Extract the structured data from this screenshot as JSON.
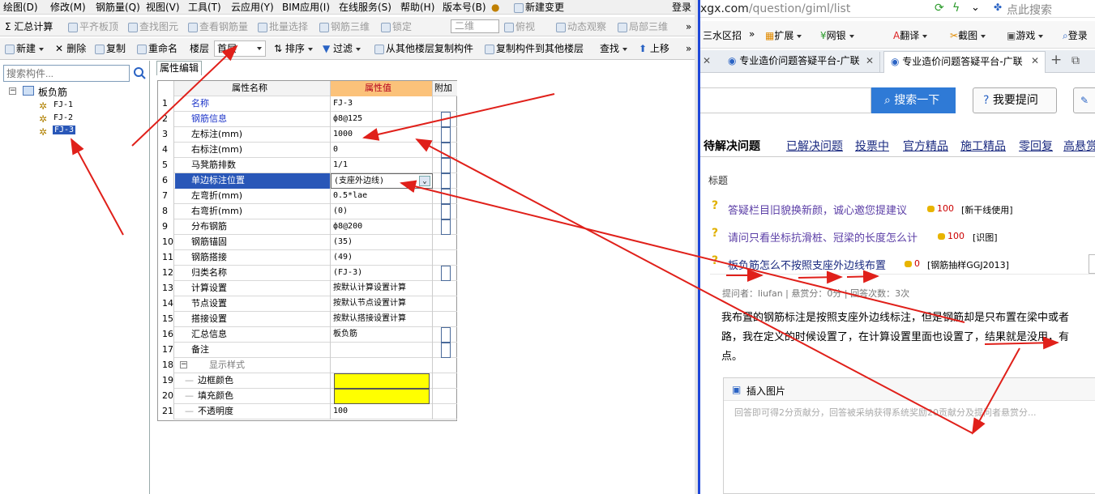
{
  "menu": {
    "items": [
      "绘图(D)",
      "修改(M)",
      "钢筋量(Q)",
      "视图(V)",
      "工具(T)",
      "云应用(Y)",
      "BIM应用(I)",
      "在线服务(S)",
      "帮助(H)",
      "版本号(B)",
      "新建变更"
    ],
    "login": "登录"
  },
  "toolbar1": {
    "summary": "Σ 汇总计算",
    "flat": "平齐板顶",
    "find": "查找图元",
    "view_rebar": "查看钢筋量",
    "batch": "批量选择",
    "rebar3d": "钢筋三维",
    "lock": "锁定",
    "view2d": "二维",
    "top_view": "俯视",
    "dynamic": "动态观察",
    "local3d": "局部三维",
    "more": "»"
  },
  "toolbar2": {
    "new": "新建",
    "delete": "删除",
    "copy": "复制",
    "rename": "重命名",
    "floor_label": "楼层",
    "floor_value": "首层",
    "sort": "排序",
    "filter": "过滤",
    "copy_from": "从其他楼层复制构件",
    "copy_to": "复制构件到其他楼层",
    "find": "查找",
    "up": "上移",
    "more": "»"
  },
  "left_panel": {
    "search_placeholder": "搜索构件...",
    "root": "板负筋",
    "items": [
      "FJ-1",
      "FJ-2",
      "FJ-3"
    ]
  },
  "property_tab": "属性编辑",
  "grid": {
    "headers": {
      "num": "",
      "name": "属性名称",
      "value": "属性值",
      "extra": "附加"
    },
    "rows": [
      {
        "n": "1",
        "name": "名称",
        "value": "FJ-3"
      },
      {
        "n": "2",
        "name": "钢筋信息",
        "value": "ф8@125"
      },
      {
        "n": "3",
        "name": "左标注(mm)",
        "value": "1000"
      },
      {
        "n": "4",
        "name": "右标注(mm)",
        "value": "0"
      },
      {
        "n": "5",
        "name": "马凳筋排数",
        "value": "1/1"
      },
      {
        "n": "6",
        "name": "单边标注位置",
        "value": "(支座外边线)"
      },
      {
        "n": "7",
        "name": "左弯折(mm)",
        "value": "0.5*lae"
      },
      {
        "n": "8",
        "name": "右弯折(mm)",
        "value": "(0)"
      },
      {
        "n": "9",
        "name": "分布钢筋",
        "value": "ф8@200"
      },
      {
        "n": "10",
        "name": "钢筋锚固",
        "value": "(35)"
      },
      {
        "n": "11",
        "name": "钢筋搭接",
        "value": "(49)"
      },
      {
        "n": "12",
        "name": "归类名称",
        "value": "(FJ-3)"
      },
      {
        "n": "13",
        "name": "计算设置",
        "value": "按默认计算设置计算"
      },
      {
        "n": "14",
        "name": "节点设置",
        "value": "按默认节点设置计算"
      },
      {
        "n": "15",
        "name": "搭接设置",
        "value": "按默认搭接设置计算"
      },
      {
        "n": "16",
        "name": "汇总信息",
        "value": "板负筋"
      },
      {
        "n": "17",
        "name": "备注",
        "value": ""
      },
      {
        "n": "18",
        "name": "显示样式",
        "value": ""
      },
      {
        "n": "19",
        "name": "边框颜色",
        "value": ""
      },
      {
        "n": "20",
        "name": "填充颜色",
        "value": ""
      },
      {
        "n": "21",
        "name": "不透明度",
        "value": "100"
      }
    ]
  },
  "browser": {
    "url_host": "xgx.com",
    "url_path": "/question/giml/list",
    "search_placeholder": "点此搜索",
    "bookmarks": [
      "三水区招",
      "»",
      "扩展",
      "网银",
      "翻译",
      "截图",
      "游戏",
      "登录"
    ],
    "tabs": [
      "专业造价问题答疑平台-广联",
      "专业造价问题答疑平台-广联"
    ],
    "search_btn": "搜索一下",
    "ask_btn": "我要提问",
    "nav": [
      "待解决问题",
      "已解决问题",
      "投票中",
      "官方精品",
      "施工精品",
      "零回复",
      "高悬赏"
    ],
    "col_title": "标题",
    "questions": [
      {
        "title": "答疑栏目旧貌换新颜，诚心邀您提建议",
        "score": "100",
        "tag": "[新干线使用]"
      },
      {
        "title": "请问只看坐标抗滑桩、冠梁的长度怎么计",
        "score": "100",
        "tag": "[识图]"
      },
      {
        "title": "板负筋怎么不按照支座外边线布置",
        "score": "0",
        "tag": "[钢筋抽样GGJ2013]"
      }
    ],
    "meta": "提问者：liufan  |  悬赏分：0分  |  回答次数：3次",
    "body_line1": "我布置的钢筋标注是按照支座外边线标注，但是钢筋却是只布置在梁中或者",
    "body_line2": "路，我在定义的时候设置了，在计算设置里面也设置了，结果就是没用，有",
    "body_line3": "点。",
    "insert_image": "插入图片",
    "answer_placeholder": "回答即可得2分贡献分，回答被采纳获得系统奖励20贡献分及提问者悬赏分..."
  },
  "colors": {
    "accent": "#1f48d9",
    "annotation": "#e0201a",
    "highlight": "#ffff00"
  }
}
